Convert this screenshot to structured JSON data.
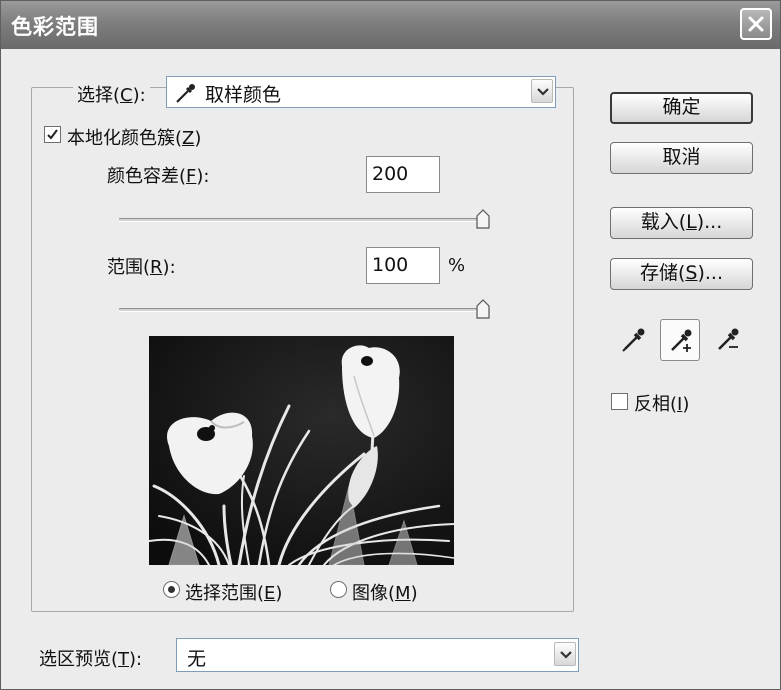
{
  "window": {
    "title": "色彩范围"
  },
  "select": {
    "label": "选择(",
    "key": "C",
    "suffix": "):",
    "value": "取样颜色"
  },
  "localized": {
    "label": "本地化颜色簇(",
    "key": "Z",
    "suffix": ")",
    "checked": true
  },
  "fuzziness": {
    "label": "颜色容差(",
    "key": "F",
    "suffix": "):",
    "value": "200"
  },
  "range": {
    "label": "范围(",
    "key": "R",
    "suffix": "):",
    "value": "100",
    "unit": "%"
  },
  "view": {
    "selection": {
      "label": "选择范围(",
      "key": "E",
      "suffix": ")",
      "selected": true
    },
    "image": {
      "label": "图像(",
      "key": "M",
      "suffix": ")",
      "selected": false
    }
  },
  "buttons": {
    "ok": "确定",
    "cancel": "取消",
    "load": {
      "label": "载入(",
      "key": "L",
      "suffix": ")..."
    },
    "save": {
      "label": "存储(",
      "key": "S",
      "suffix": ")..."
    }
  },
  "invert": {
    "label": "反相(",
    "key": "I",
    "suffix": ")",
    "checked": false
  },
  "preview_select": {
    "label": "选区预览(",
    "key": "T",
    "suffix": "):",
    "value": "无"
  }
}
